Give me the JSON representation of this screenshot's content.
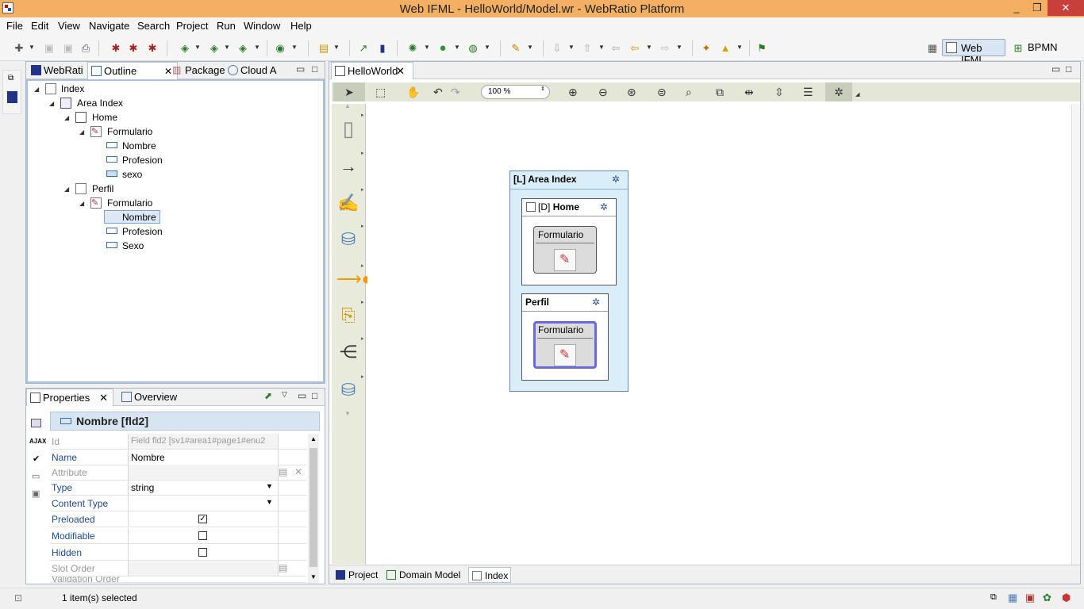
{
  "window": {
    "title": "Web IFML - HelloWorld/Model.wr - WebRatio Platform",
    "minimize": "_",
    "maximize": "❐",
    "close": "✕"
  },
  "menu": [
    "File",
    "Edit",
    "View",
    "Navigate",
    "Search",
    "Project",
    "Run",
    "Window",
    "Help"
  ],
  "perspectives": {
    "active": "Web IFML",
    "other": "BPMN"
  },
  "left_tabs": [
    "WebRati",
    "Outline",
    "Package",
    "Cloud A"
  ],
  "outline_tree": [
    {
      "label": "Index"
    },
    {
      "label": "Area Index"
    },
    {
      "label": "Home"
    },
    {
      "label": "Formulario"
    },
    {
      "label": "Nombre"
    },
    {
      "label": "Profesion"
    },
    {
      "label": "sexo"
    },
    {
      "label": "Perfil"
    },
    {
      "label": "Formulario"
    },
    {
      "label": "Nombre"
    },
    {
      "label": "Profesion"
    },
    {
      "label": "Sexo"
    }
  ],
  "bottom_left_tabs": [
    "Properties",
    "Overview"
  ],
  "properties": {
    "header": "Nombre [fld2]",
    "side_label": "AJAX",
    "rows": [
      {
        "key": "Id",
        "value": "Field fld2  [sv1#area1#page1#enu2"
      },
      {
        "key": "Name",
        "value": "Nombre"
      },
      {
        "key": "Attribute",
        "value": ""
      },
      {
        "key": "Type",
        "value": "string"
      },
      {
        "key": "Content Type",
        "value": ""
      },
      {
        "key": "Preloaded",
        "value": "✓"
      },
      {
        "key": "Modifiable",
        "value": ""
      },
      {
        "key": "Hidden",
        "value": ""
      },
      {
        "key": "Slot Order",
        "value": ""
      },
      {
        "key": "Validation Order",
        "value": ""
      }
    ]
  },
  "editor": {
    "tab": "HelloWorld",
    "zoom": "100 %",
    "area": {
      "title": "[L] Area Index"
    },
    "home": {
      "prefix": "[D]",
      "title": "Home",
      "unit": "Formulario"
    },
    "perfil": {
      "title": "Perfil",
      "unit": "Formulario"
    },
    "bottom_tabs": [
      "Project",
      "Domain Model",
      "Index"
    ]
  },
  "status": {
    "text": "1 item(s) selected"
  },
  "colors": {
    "title_bar": "#f3b064",
    "area_bg": "#d9eef9",
    "selected_unit": "#6a6adb"
  }
}
